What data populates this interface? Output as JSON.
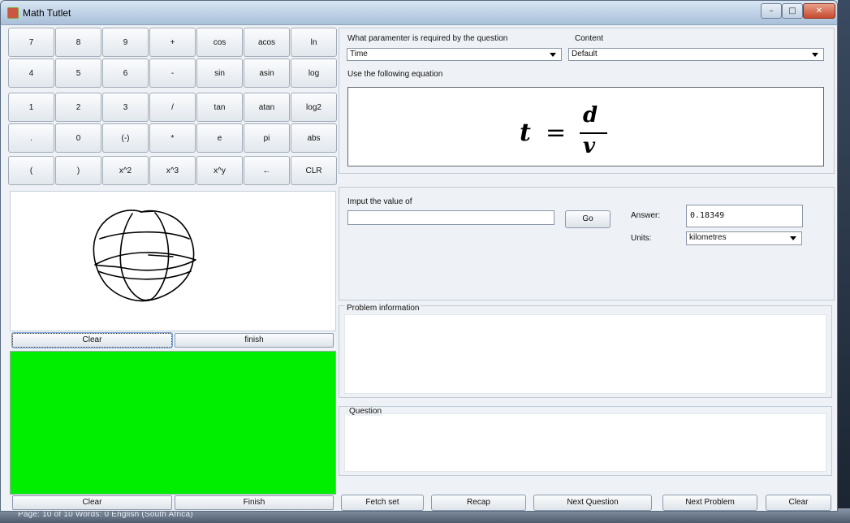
{
  "window": {
    "title": "Math Tutlet",
    "controls": {
      "minimize": "–",
      "maximize": "□",
      "close": "✕"
    }
  },
  "calculator": {
    "rows": [
      [
        "7",
        "8",
        "9",
        "+",
        "cos",
        "acos",
        "ln"
      ],
      [
        "4",
        "5",
        "6",
        "-",
        "sin",
        "asin",
        "log"
      ],
      [
        "1",
        "2",
        "3",
        "/",
        "tan",
        "atan",
        "log2"
      ],
      [
        ".",
        "0",
        "(-)",
        "*",
        "e",
        "pi",
        "abs"
      ],
      [
        "(",
        ")",
        "x^2",
        "x^3",
        "x^y",
        "←",
        "CLR"
      ]
    ]
  },
  "drawing_pad": {
    "clear_label": "Clear",
    "finish_label": "finish"
  },
  "output_area": {
    "clear_label": "Clear",
    "finish_label": "Finish",
    "color": "#00ee00"
  },
  "question_setup": {
    "param_label": "What paramenter is required by the question",
    "param_value": "Time",
    "content_label": "Content",
    "content_value": "Default",
    "equation_label": "Use the following equation",
    "equation": {
      "lhs": "t",
      "eq": "=",
      "numerator": "d",
      "denominator": "v"
    }
  },
  "input_section": {
    "input_label": "Imput the value of",
    "input_value": "",
    "go_label": "Go",
    "answer_label": "Answer:",
    "answer_value": "0.18349",
    "units_label": "Units:",
    "units_value": "kilometres"
  },
  "problem_info": {
    "legend": "Problem information",
    "text": ""
  },
  "question": {
    "legend": "Question",
    "text": ""
  },
  "bottom_buttons": {
    "fetch_set": "Fetch set",
    "recap": "Recap",
    "next_question": "Next Question",
    "next_problem": "Next Problem",
    "clear": "Clear"
  },
  "taskbar": {
    "text": "Page: 10 of 10   Words: 0   English (South Africa)"
  }
}
